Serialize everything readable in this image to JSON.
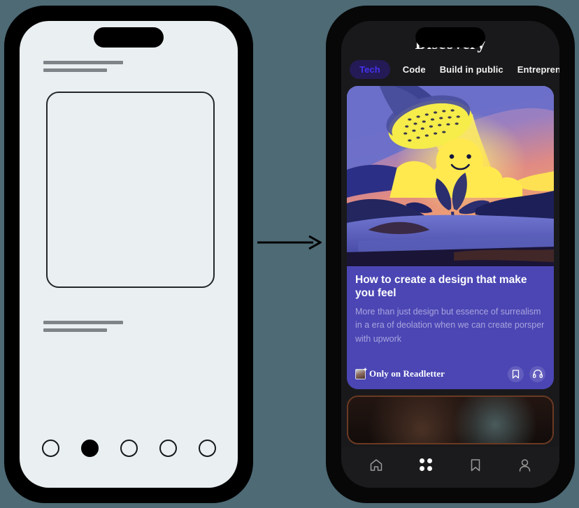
{
  "canvas": {
    "background_color": "#4d6a75"
  },
  "flow": {
    "arrow": {
      "name": "transform-arrow",
      "direction": "right"
    }
  },
  "wireframe_phone": {
    "name": "wireframe-mockup",
    "screen_color": "#eaeff1",
    "frame_color": "#000000",
    "notch": "dynamic-island",
    "placeholder_lines_top": [
      "line-long",
      "line-short"
    ],
    "placeholder_card": "empty-content-box",
    "placeholder_lines_bottom": [
      "line-long",
      "line-short"
    ],
    "dots": [
      {
        "label": "dot-1",
        "filled": false
      },
      {
        "label": "dot-2",
        "filled": true
      },
      {
        "label": "dot-3",
        "filled": false
      },
      {
        "label": "dot-4",
        "filled": false
      },
      {
        "label": "dot-5",
        "filled": false
      }
    ]
  },
  "app_phone": {
    "name": "readletter-discovery-app",
    "screen_color": "#19191b",
    "header": {
      "title": "Discovery"
    },
    "tabs": [
      {
        "label": "Tech",
        "active": true
      },
      {
        "label": "Code",
        "active": false
      },
      {
        "label": "Build in public",
        "active": false
      },
      {
        "label": "Entreprenourhsi",
        "active": false
      }
    ],
    "tab_colors": {
      "active_bg": "#241a55",
      "active_text": "#4432f0",
      "text": "#f2f2f2"
    },
    "feed": {
      "cards": [
        {
          "name": "featured-article-card",
          "background_color": "#4b46b4",
          "illustration": "watering-can-plant-illustration",
          "title": "How to create a design that make you feel",
          "subtitle": "More than just design but essence of surrealism in a era of deolation when we can create porsper with upwork",
          "footer_label": "Only on Readletter",
          "footer_icons": [
            "bookmark-icon",
            "headphones-icon"
          ]
        },
        {
          "name": "second-article-card",
          "background_color": "#2b1a12",
          "border_color": "#6b3a22",
          "illustration": "dark-photo-thumbnail"
        }
      ]
    },
    "bottom_nav": [
      {
        "label": "Home",
        "icon": "home-icon",
        "active": false
      },
      {
        "label": "Discover",
        "icon": "grid-dots-icon",
        "active": true
      },
      {
        "label": "Saved",
        "icon": "bookmark-icon",
        "active": false
      },
      {
        "label": "Profile",
        "icon": "person-icon",
        "active": false
      }
    ]
  }
}
